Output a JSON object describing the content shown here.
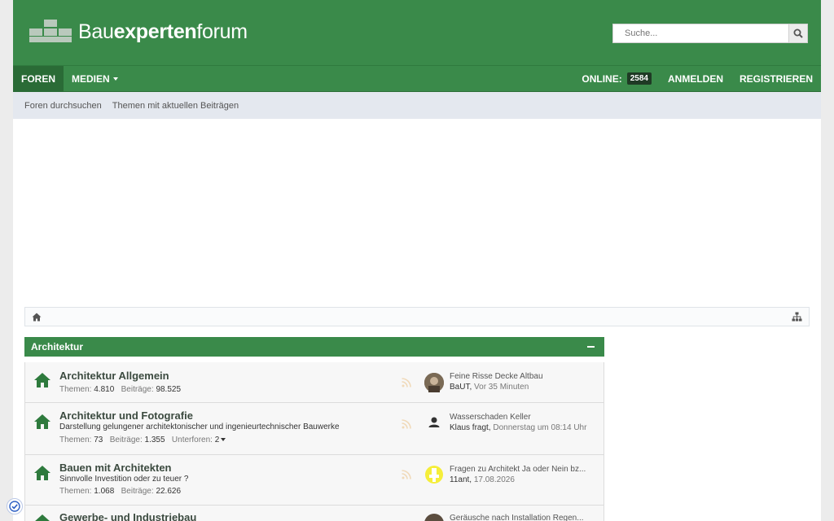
{
  "header": {
    "logo_text_pre": "Bau",
    "logo_text_bold": "experten",
    "logo_text_post": "forum",
    "search_placeholder": "Suche..."
  },
  "nav": {
    "foren": "Foren",
    "medien": "Medien",
    "online_label": "Online:",
    "online_count": "2584",
    "anmelden": "Anmelden",
    "registrieren": "Registrieren"
  },
  "subnav": {
    "items": [
      "Foren durchsuchen",
      "Themen mit aktuellen Beiträgen"
    ]
  },
  "category": {
    "title": "Architektur"
  },
  "forums": [
    {
      "title": "Architektur Allgemein",
      "description": "",
      "themen_label": "Themen:",
      "themen": "4.810",
      "beitraege_label": "Beiträge:",
      "beitraege": "98.525",
      "unterforen_label": "",
      "unterforen": "",
      "last_title": "Feine Risse Decke Altbau",
      "last_user": "BaUT,",
      "last_time": "Vor 35 Minuten"
    },
    {
      "title": "Architektur und Fotografie",
      "description": "Darstellung gelungener architektonischer und ingenieurtechnischer Bauwerke",
      "themen_label": "Themen:",
      "themen": "73",
      "beitraege_label": "Beiträge:",
      "beitraege": "1.355",
      "unterforen_label": "Unterforen:",
      "unterforen": "2",
      "last_title": "Wasserschaden Keller",
      "last_user": "Klaus fragt,",
      "last_time": "Donnerstag um 08:14 Uhr"
    },
    {
      "title": "Bauen mit Architekten",
      "description": "Sinnvolle Investition oder zu teuer ?",
      "themen_label": "Themen:",
      "themen": "1.068",
      "beitraege_label": "Beiträge:",
      "beitraege": "22.626",
      "unterforen_label": "",
      "unterforen": "",
      "last_title": "Fragen zu Architekt Ja oder Nein bz...",
      "last_user": "11ant,",
      "last_time": "17.08.2026"
    },
    {
      "title": "Gewerbe- und Industriebau",
      "description": "",
      "themen_label": "",
      "themen": "",
      "beitraege_label": "",
      "beitraege": "",
      "unterforen_label": "",
      "unterforen": "",
      "last_title": "Geräusche nach Installation Regen...",
      "last_user": "",
      "last_time": ""
    }
  ],
  "colors": {
    "brand_green": "#3a8a4a",
    "nav_active": "#2a6b36",
    "subnav_bg": "#e4e8ef"
  },
  "icons": [
    "search-icon",
    "home-icon",
    "sitemap-icon",
    "forum-house-icon",
    "rss-icon",
    "user-icon",
    "privacy-check-icon"
  ]
}
